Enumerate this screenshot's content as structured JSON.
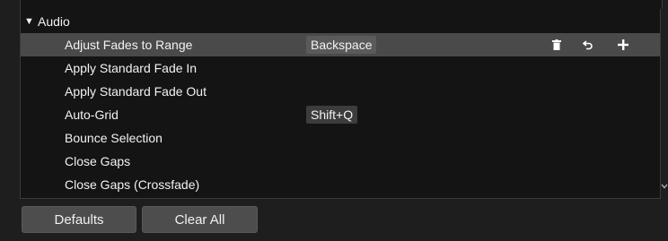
{
  "group": {
    "arrow": "▼",
    "label": "Audio"
  },
  "commands": [
    {
      "label": "Adjust Fades to Range",
      "shortcut": "Backspace",
      "selected": true
    },
    {
      "label": "Apply Standard Fade In",
      "shortcut": "",
      "selected": false
    },
    {
      "label": "Apply Standard Fade Out",
      "shortcut": "",
      "selected": false
    },
    {
      "label": "Auto-Grid",
      "shortcut": "Shift+Q",
      "selected": false
    },
    {
      "label": "Bounce Selection",
      "shortcut": "",
      "selected": false
    },
    {
      "label": "Close Gaps",
      "shortcut": "",
      "selected": false
    },
    {
      "label": "Close Gaps (Crossfade)",
      "shortcut": "",
      "selected": false
    }
  ],
  "row_actions": {
    "icons": [
      "trash-icon",
      "undo-icon",
      "plus-icon"
    ]
  },
  "buttons": {
    "defaults_label": "Defaults",
    "clear_all_label": "Clear All"
  },
  "colors": {
    "background": "#1e1e1e",
    "list_background": "#141414",
    "selected_row": "#4a4a4a",
    "shortcut_chip": "#3c3c3c",
    "button": "#4d4d4d",
    "text": "#f2f2f2"
  }
}
